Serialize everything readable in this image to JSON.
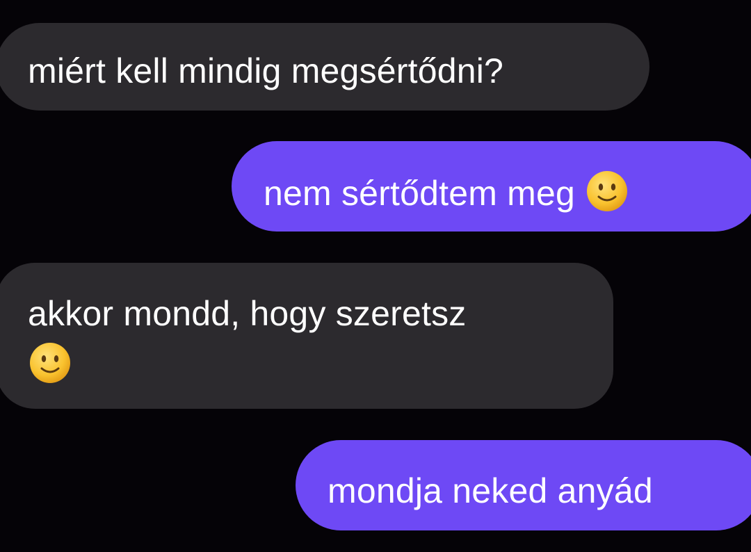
{
  "messages": [
    {
      "direction": "incoming",
      "text": "miért kell mindig megsértődni?",
      "emoji": null
    },
    {
      "direction": "outgoing",
      "text": "nem sértődtem meg",
      "emoji": "slightly-smiling-face-icon"
    },
    {
      "direction": "incoming",
      "text": "akkor mondd, hogy szeretsz",
      "emoji": "slightly-smiling-face-icon"
    },
    {
      "direction": "outgoing",
      "text": "mondja neked anyád",
      "emoji": null
    }
  ],
  "colors": {
    "background": "#050307",
    "incoming_bubble": "#2c2a2e",
    "outgoing_bubble": "#6e49f5",
    "text": "#ffffff"
  }
}
